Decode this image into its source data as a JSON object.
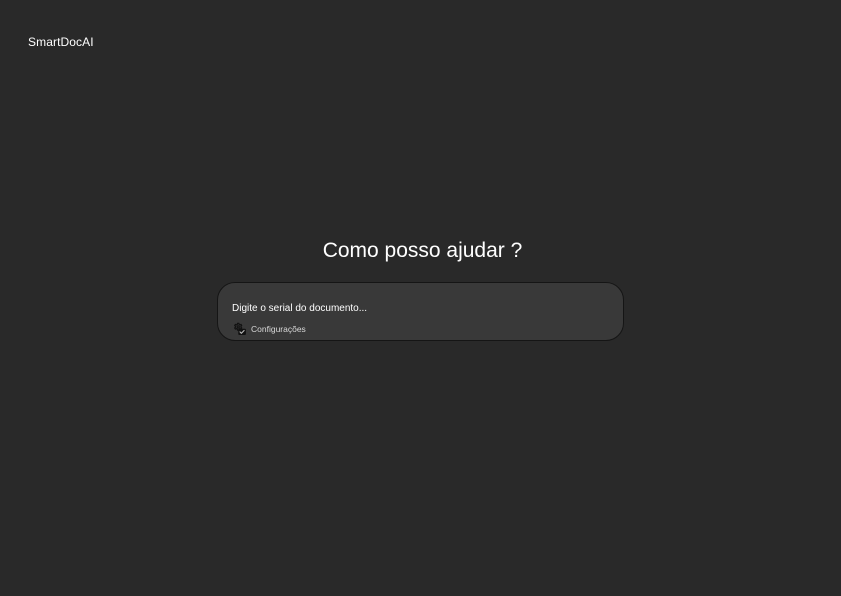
{
  "header": {
    "brand": "SmartDocAI"
  },
  "main": {
    "headline": "Como posso ajudar ?",
    "prompt": {
      "placeholder": "Digite o serial do documento...",
      "value": "",
      "settings_label": "Configurações",
      "settings_icon": "settings-gear-icon"
    }
  },
  "colors": {
    "background": "#292929",
    "prompt_background": "#393939",
    "prompt_border": "#151515",
    "text": "#ffffff"
  }
}
